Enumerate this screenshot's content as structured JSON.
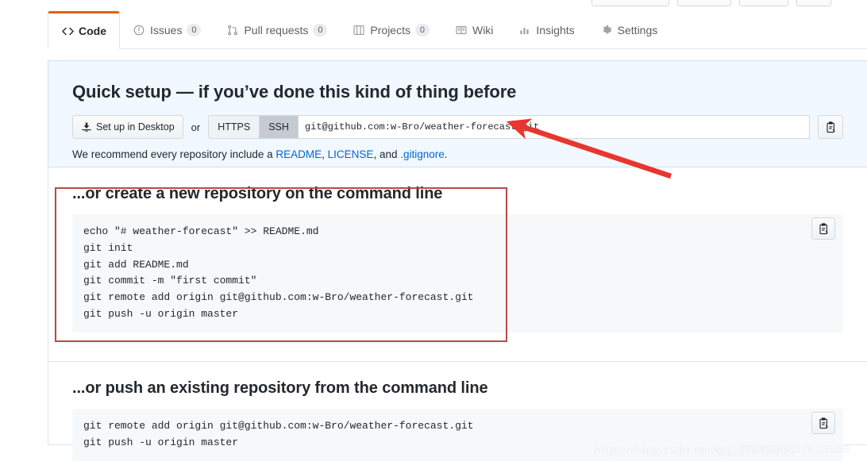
{
  "nav": {
    "tabs": [
      {
        "label": "Code",
        "icon": "code-icon",
        "count": null,
        "active": true
      },
      {
        "label": "Issues",
        "icon": "issue-opened-icon",
        "count": "0",
        "active": false
      },
      {
        "label": "Pull requests",
        "icon": "git-pull-request-icon",
        "count": "0",
        "active": false
      },
      {
        "label": "Projects",
        "icon": "project-board-icon",
        "count": "0",
        "active": false
      },
      {
        "label": "Wiki",
        "icon": "book-icon",
        "count": null,
        "active": false
      },
      {
        "label": "Insights",
        "icon": "graph-icon",
        "count": null,
        "active": false
      },
      {
        "label": "Settings",
        "icon": "gear-icon",
        "count": null,
        "active": false
      }
    ]
  },
  "quick_setup": {
    "heading": "Quick setup — if you’ve done this kind of thing before",
    "desktop_button": "Set up in Desktop",
    "desktop_icon": "desktop-download-icon",
    "or_label": "or",
    "protocols": [
      {
        "label": "HTTPS",
        "selected": false
      },
      {
        "label": "SSH",
        "selected": true
      }
    ],
    "clone_url": "git@github.com:w-Bro/weather-forecast.git",
    "copy_icon": "clipboard-icon",
    "recommend": {
      "prefix": "We recommend every repository include a ",
      "link_readme": "README",
      "sep1": ", ",
      "link_license": "LICENSE",
      "sep2": ", and ",
      "link_gitignore": ".gitignore",
      "suffix": "."
    }
  },
  "create_section": {
    "heading": "...or create a new repository on the command line",
    "code": "echo \"# weather-forecast\" >> README.md\ngit init\ngit add README.md\ngit commit -m \"first commit\"\ngit remote add origin git@github.com:w-Bro/weather-forecast.git\ngit push -u origin master",
    "copy_icon": "clipboard-icon"
  },
  "push_section": {
    "heading": "...or push an existing repository from the command line",
    "code": "git remote add origin git@github.com:w-Bro/weather-forecast.git\ngit push -u origin master",
    "copy_icon": "clipboard-icon"
  },
  "annotations": {
    "arrow_color": "#e8352e",
    "box_color": "#b94a48"
  },
  "watermark": {
    "text": "https://blog.csdn.net/qq_37818568",
    "overlay": "csdn/blog/qq_37818568"
  }
}
